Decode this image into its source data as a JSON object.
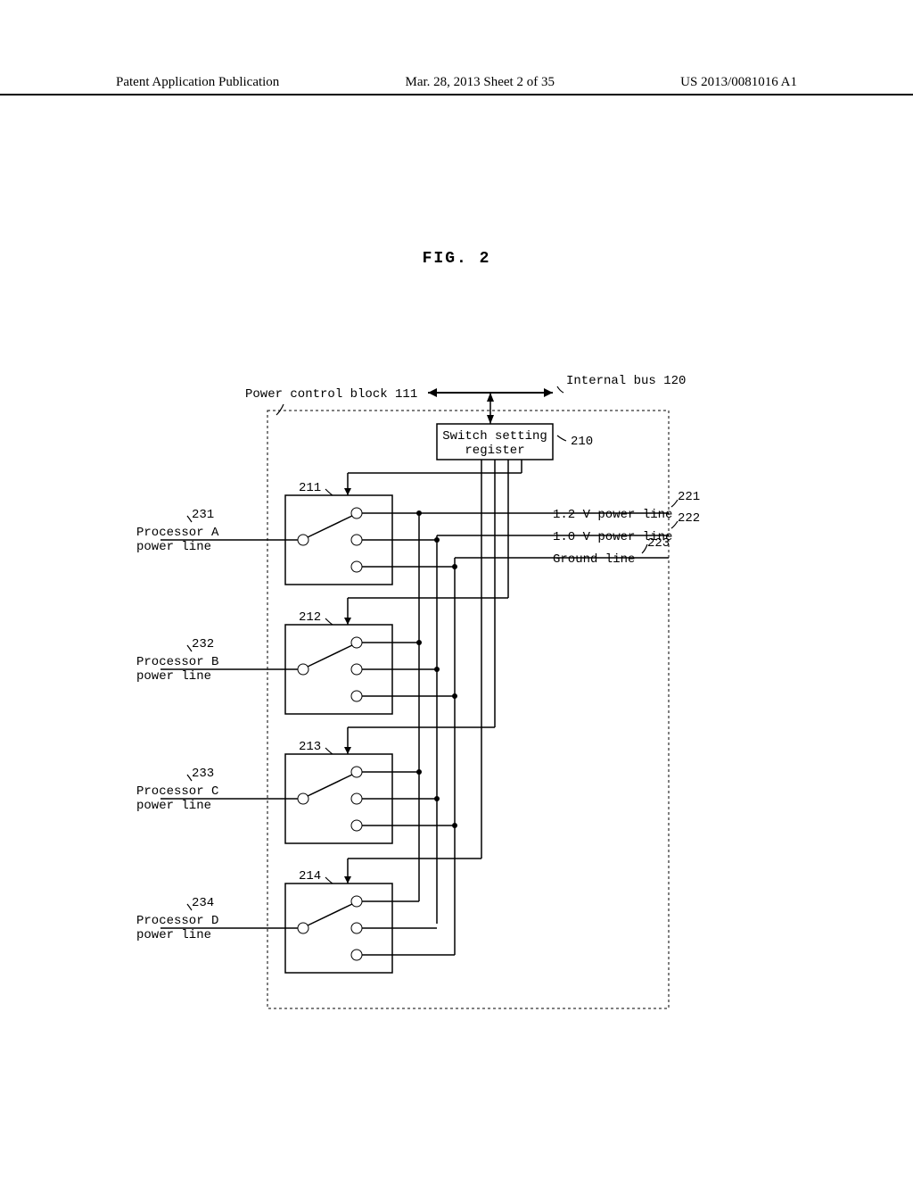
{
  "header": {
    "left": "Patent Application Publication",
    "center": "Mar. 28, 2013  Sheet 2 of 35",
    "right": "US 2013/0081016 A1"
  },
  "figure": {
    "title": "FIG. 2",
    "block_label": "Power control block 111",
    "bus_label": "Internal bus 120",
    "register": "Switch setting register",
    "register_ref": "210",
    "switches": [
      {
        "ref": "211"
      },
      {
        "ref": "212"
      },
      {
        "ref": "213"
      },
      {
        "ref": "214"
      }
    ],
    "left_labels": [
      {
        "ref": "231",
        "name": "Processor A",
        "sub": "power line"
      },
      {
        "ref": "232",
        "name": "Processor B",
        "sub": "power line"
      },
      {
        "ref": "233",
        "name": "Processor C",
        "sub": "power line"
      },
      {
        "ref": "234",
        "name": "Processor D",
        "sub": "power line"
      }
    ],
    "right_labels": [
      {
        "ref": "221",
        "name": "1.2 V power line"
      },
      {
        "ref": "222",
        "name": "1.0 V power line"
      },
      {
        "ref": "223",
        "name": "Ground line"
      }
    ]
  }
}
